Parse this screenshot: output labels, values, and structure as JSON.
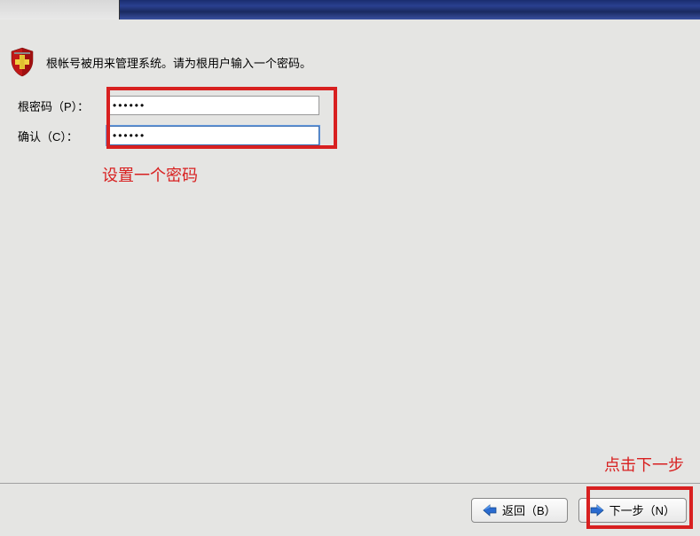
{
  "intro": {
    "text": "根帐号被用来管理系统。请为根用户输入一个密码。"
  },
  "form": {
    "password_label": "根密码（P）：",
    "password_value": "••••••",
    "confirm_label": "确认（C）：",
    "confirm_value": "••••••"
  },
  "annotations": {
    "set_password": "设置一个密码",
    "click_next": "点击下一步"
  },
  "buttons": {
    "back": "返回（B）",
    "next": "下一步（N）"
  },
  "colors": {
    "highlight": "#d82020",
    "accent_blue": "#2a6bd0"
  }
}
